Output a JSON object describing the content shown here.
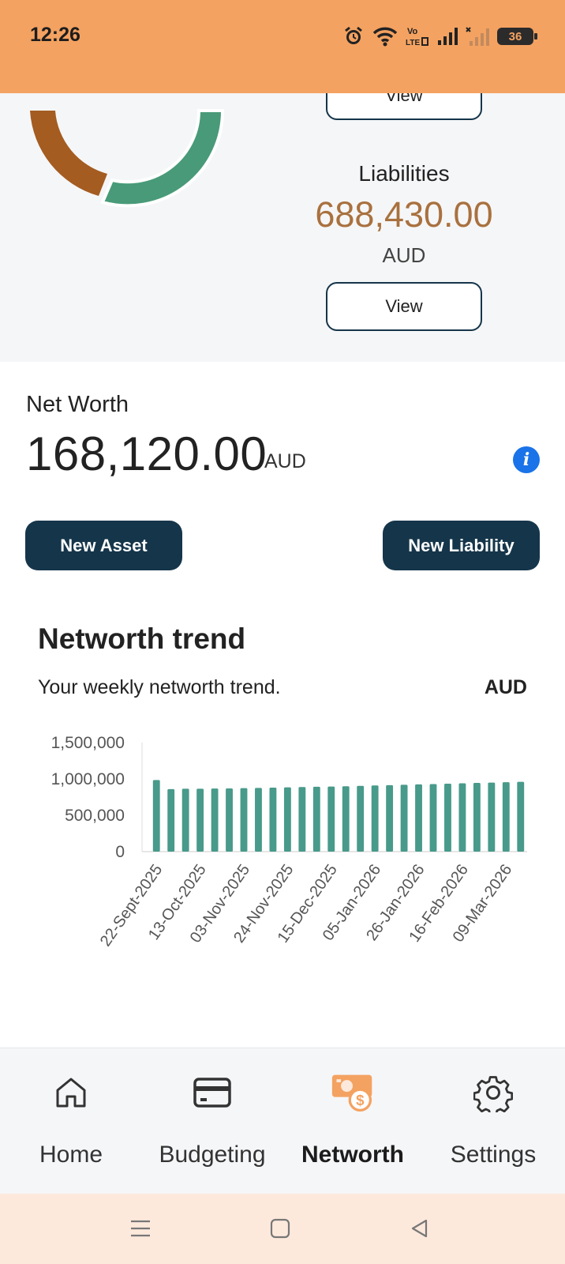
{
  "status_bar": {
    "time": "12:26",
    "battery": "36",
    "icons": [
      "alarm-icon",
      "wifi-icon",
      "volte-icon",
      "signal-icon",
      "signal-no-service-icon",
      "battery-icon"
    ]
  },
  "summary": {
    "top_view_label": "View",
    "liabilities": {
      "title": "Liabilities",
      "value": "688,430.00",
      "currency": "AUD",
      "view_label": "View"
    },
    "donut_colors": {
      "assets": "#489a78",
      "liabilities": "#a45c21"
    }
  },
  "networth": {
    "label": "Net Worth",
    "value": "168,120.00",
    "currency": "AUD",
    "new_asset_label": "New Asset",
    "new_liability_label": "New Liability"
  },
  "trend": {
    "title": "Networth trend",
    "subtitle": "Your weekly networth trend.",
    "currency": "AUD"
  },
  "chart_data": {
    "type": "bar",
    "title": "",
    "xlabel": "",
    "ylabel": "",
    "ylim": [
      0,
      1500000
    ],
    "yticks": [
      "0",
      "500,000",
      "1,000,000",
      "1,500,000"
    ],
    "xtick_labels": [
      "22-Sept-2025",
      "13-Oct-2025",
      "03-Nov-2025",
      "24-Nov-2025",
      "15-Dec-2025",
      "05-Jan-2026",
      "26-Jan-2026",
      "16-Feb-2026",
      "09-Mar-2026"
    ],
    "values": [
      985000,
      860000,
      865000,
      865000,
      868000,
      870000,
      873000,
      876000,
      880000,
      884000,
      888000,
      892000,
      896000,
      900000,
      905000,
      910000,
      915000,
      920000,
      925000,
      930000,
      935000,
      940000,
      945000,
      950000,
      955000,
      960000
    ],
    "grid": false,
    "legend": "none",
    "bar_color": "#489a8a"
  },
  "bottom_nav": {
    "items": [
      {
        "label": "Home",
        "icon": "home-icon"
      },
      {
        "label": "Budgeting",
        "icon": "card-icon"
      },
      {
        "label": "Networth",
        "icon": "money-icon",
        "active": true
      },
      {
        "label": "Settings",
        "icon": "gear-icon"
      }
    ],
    "active_color": "#f4a261"
  },
  "system_nav": {
    "buttons": [
      "menu-icon",
      "home-square-icon",
      "back-icon"
    ]
  }
}
